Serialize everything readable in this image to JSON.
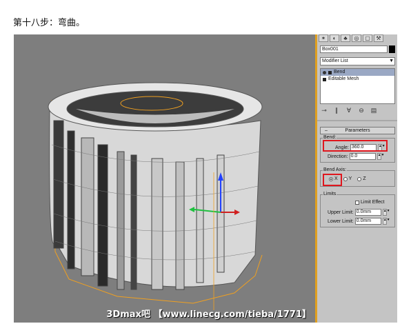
{
  "caption": "第十八步：弯曲。",
  "watermark": "3Dmax吧 【www.linecg.com/tieba/1771】",
  "colors": {
    "viewport_bg": "#7e7e7e",
    "panel_bg": "#c4c4c4",
    "highlight": "#e0161d",
    "gizmo": "#f0a020"
  },
  "panel": {
    "command_tabs": [
      "create-icon",
      "modify-icon",
      "hierarchy-icon",
      "motion-icon",
      "display-icon",
      "utilities-icon"
    ],
    "object_name": "Box001",
    "modifier_list": "Modifier List",
    "stack": [
      {
        "label": "Bend",
        "selected": true
      },
      {
        "label": "Editable Mesh",
        "selected": false
      }
    ],
    "parameters_title": "Parameters",
    "bend_group": "Bend:",
    "angle_label": "Angle:",
    "angle_value": "360.0",
    "direction_label": "Direction:",
    "direction_value": "0.0",
    "axis_group": "Bend Axis:",
    "axis_x": "X",
    "axis_y": "Y",
    "axis_z": "Z",
    "limits_group": "Limits",
    "limit_effect": "Limit Effect",
    "upper_label": "Upper Limit:",
    "upper_value": "0.0mm",
    "lower_label": "Lower Limit:",
    "lower_value": "0.0mm"
  }
}
